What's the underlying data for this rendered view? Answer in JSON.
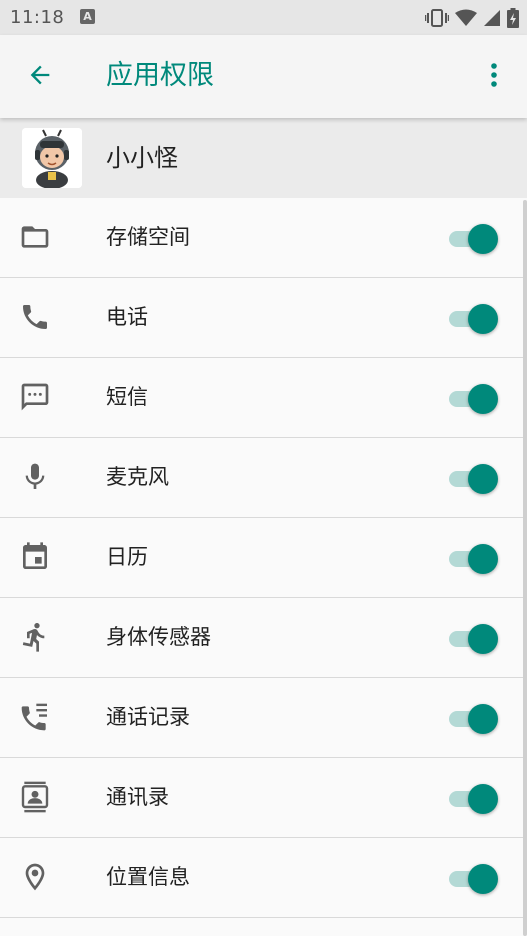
{
  "status_bar": {
    "time": "11:18",
    "notification_icon": "A"
  },
  "app_bar": {
    "title": "应用权限"
  },
  "app": {
    "name": "小小怪"
  },
  "permissions": [
    {
      "label": "存储空间",
      "icon": "folder-icon",
      "enabled": true
    },
    {
      "label": "电话",
      "icon": "phone-icon",
      "enabled": true
    },
    {
      "label": "短信",
      "icon": "sms-icon",
      "enabled": true
    },
    {
      "label": "麦克风",
      "icon": "microphone-icon",
      "enabled": true
    },
    {
      "label": "日历",
      "icon": "calendar-icon",
      "enabled": true
    },
    {
      "label": "身体传感器",
      "icon": "body-sensor-icon",
      "enabled": true
    },
    {
      "label": "通话记录",
      "icon": "call-log-icon",
      "enabled": true
    },
    {
      "label": "通讯录",
      "icon": "contacts-icon",
      "enabled": true
    },
    {
      "label": "位置信息",
      "icon": "location-icon",
      "enabled": true
    }
  ],
  "colors": {
    "accent": "#00897b",
    "switch_track": "#b3d9d5",
    "icon": "#616161"
  }
}
